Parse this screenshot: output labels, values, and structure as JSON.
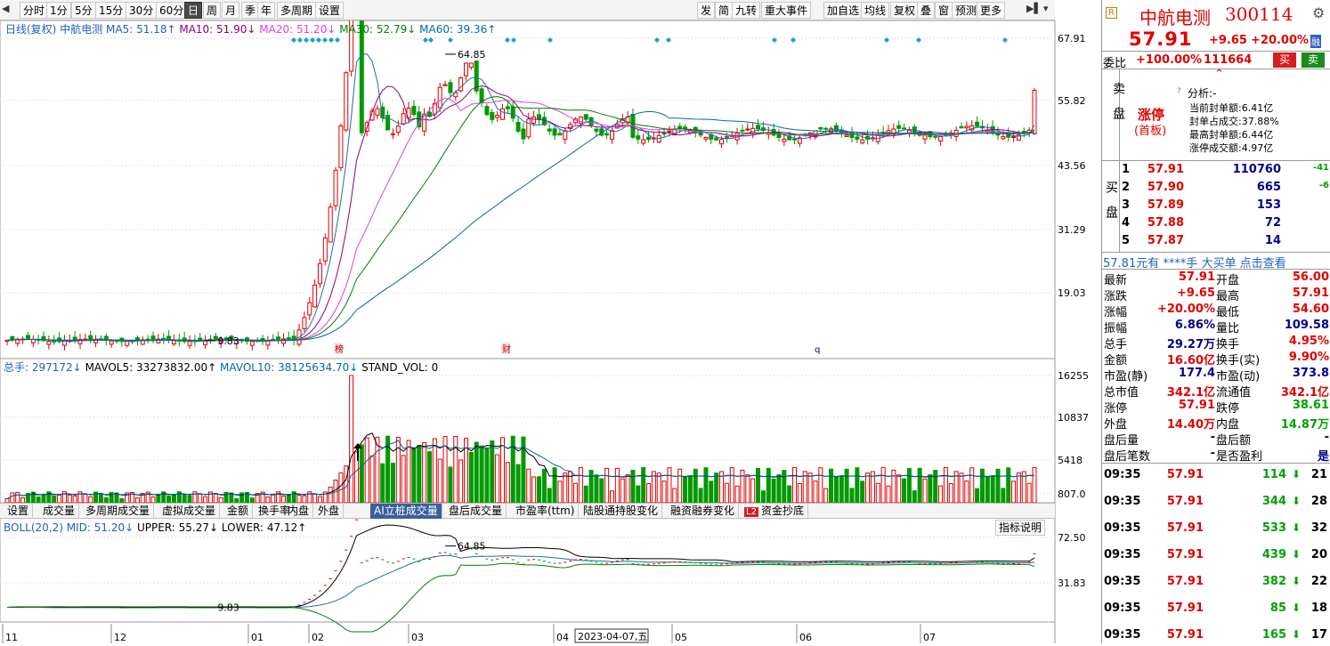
{
  "toolbar": {
    "periods": [
      "分时",
      "1分",
      "5分",
      "15分",
      "30分",
      "60分",
      "日",
      "周",
      "月",
      "季",
      "年",
      "多周期",
      "设置"
    ],
    "active": "日",
    "right": [
      "发",
      "简",
      "九转",
      "重大事件",
      "加自选",
      "均线",
      "复权",
      "叠",
      "窗",
      "预测",
      "更多"
    ]
  },
  "ma_legend": {
    "title": "日线(复权)",
    "name": "中航电测",
    "ma5": "MA5: 51.18↑",
    "ma10": "MA10: 51.90↓",
    "ma20": "MA20: 51.20↓",
    "ma30": "MA30: 52.79↓",
    "ma60": "MA60: 39.36↑"
  },
  "price_axis": [
    "67.91",
    "55.82",
    "43.56",
    "31.29",
    "19.03"
  ],
  "price_marks": {
    "high": "64.85",
    "low": "9.83"
  },
  "event_marks": [
    "榜",
    "财",
    "q"
  ],
  "vol_legend": {
    "total": "总手: 297172↓",
    "mavol5": "MAVOL5: 33273832.00↑",
    "mavol10": "MAVOL10: 38125634.70↓",
    "stand": "STAND_VOL: 0"
  },
  "vol_axis": [
    "16255",
    "10837",
    "5418",
    "807.0"
  ],
  "ind_tabs": [
    "设置",
    "成交量",
    "多周期成交量",
    "虚拟成交量",
    "金额",
    "换手率",
    "内盘",
    "外盘",
    "AI立桩成交量",
    "盘后成交量",
    "市盈率(ttm)",
    "陆股通持股变化",
    "融资融券变化",
    "资金抄底"
  ],
  "ind_active": "AI立桩成交量",
  "ind_badge": "L2",
  "boll_legend": {
    "title": "BOLL(20,2)",
    "mid": "MID: 51.20↓",
    "upper": "UPPER: 55.27↓",
    "lower": "LOWER: 47.12↑"
  },
  "boll_axis": [
    "72.50",
    "31.83"
  ],
  "boll_btn": "指标说明",
  "time_axis": [
    "11",
    "12",
    "01",
    "02",
    "03",
    "04",
    "05",
    "06",
    "07"
  ],
  "time_cursor": "2023-04-07,五",
  "quote": {
    "tag": "R",
    "name": "中航电测",
    "code": "300114",
    "price": "57.91",
    "chg": "+9.65",
    "pct": "+20.00%",
    "badge": "融",
    "weibi": "委比",
    "weibi_v": "+100.00%",
    "weibi_n": "111664",
    "buy": "买",
    "sell": "卖",
    "sell_label": "卖盘",
    "limit": "涨停",
    "first": "(首板)",
    "analysis": "分析:-",
    "info": [
      "当前封单额:6.41亿",
      "封单占成交:37.88%",
      "最高封单额:6.44亿",
      "涨停成交额:4.97亿"
    ],
    "buy_label": "买盘",
    "bids": [
      [
        "1",
        "57.91",
        "110760",
        "-41"
      ],
      [
        "2",
        "57.90",
        "665",
        "-6"
      ],
      [
        "3",
        "57.89",
        "153",
        ""
      ],
      [
        "4",
        "57.88",
        "72",
        ""
      ],
      [
        "5",
        "57.87",
        "14",
        ""
      ]
    ],
    "bigorder": "57.81元有 ****手 大买单 点击查看",
    "stats": [
      [
        "最新",
        "57.91",
        "开盘",
        "56.00"
      ],
      [
        "涨跌",
        "+9.65",
        "最高",
        "57.91"
      ],
      [
        "涨幅",
        "+20.00%",
        "最低",
        "54.60"
      ],
      [
        "振幅",
        "6.86%",
        "量比",
        "109.58"
      ],
      [
        "总手",
        "29.27万",
        "换手",
        "4.95%"
      ],
      [
        "金额",
        "16.60亿",
        "换手(实)",
        "9.90%"
      ],
      [
        "市盈(静)",
        "177.4",
        "市盈(动)",
        "373.8"
      ],
      [
        "总市值",
        "342.1亿",
        "流通值",
        "342.1亿"
      ],
      [
        "涨停",
        "57.91",
        "跌停",
        "38.61"
      ],
      [
        "外盘",
        "14.40万",
        "内盘",
        "14.87万"
      ],
      [
        "盘后量",
        "-",
        "盘后额",
        "-"
      ],
      [
        "盘后笔数",
        "-",
        "是否盈利",
        "是"
      ]
    ],
    "ticks": [
      [
        "09:35",
        "57.91",
        "114",
        "21"
      ],
      [
        "09:35",
        "57.91",
        "344",
        "28"
      ],
      [
        "09:35",
        "57.91",
        "533",
        "32"
      ],
      [
        "09:35",
        "57.91",
        "439",
        "20"
      ],
      [
        "09:35",
        "57.91",
        "382",
        "22"
      ],
      [
        "09:35",
        "57.91",
        "85",
        "18"
      ],
      [
        "09:35",
        "57.91",
        "165",
        "17"
      ]
    ]
  },
  "colors": {
    "up": "#e00000",
    "down": "#009a00",
    "ma5": "#000000",
    "ma10": "#8a0080",
    "ma20": "#e040e0",
    "ma30": "#008000",
    "ma60": "#006aa8"
  }
}
